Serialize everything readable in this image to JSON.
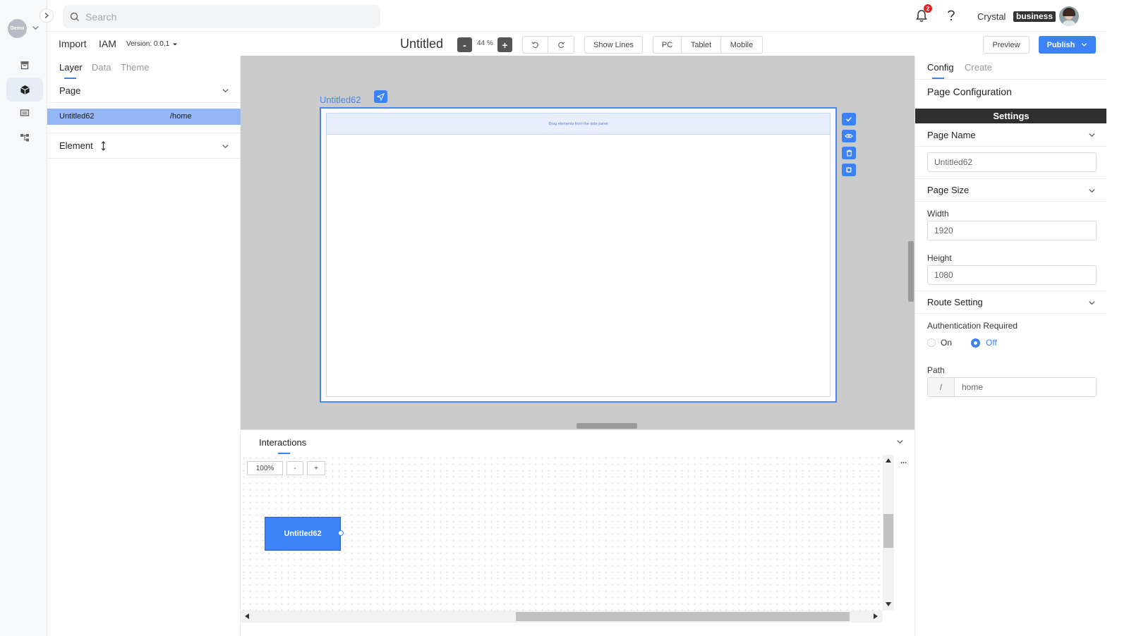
{
  "rail": {
    "workspace_label": "Demo"
  },
  "topbar": {
    "search_placeholder": "Search",
    "notification_count": "2",
    "user_name": "Crystal",
    "plan_badge": "business"
  },
  "toolbar": {
    "menu_import": "Import",
    "menu_iam": "IAM",
    "version_label": "Version: 0.0.1",
    "doc_title": "Untitled",
    "zoom_minus": "-",
    "zoom_value": "44 %",
    "zoom_plus": "+",
    "show_lines": "Show Lines",
    "device_pc": "PC",
    "device_tablet": "Tablet",
    "device_mobile": "Mobile",
    "preview": "Preview",
    "publish": "Publish"
  },
  "left_panel": {
    "tabs": [
      "Layer",
      "Data",
      "Theme"
    ],
    "page_section": "Page",
    "page_row": {
      "name": "Untitled62",
      "route": "/home"
    },
    "element_section": "Element"
  },
  "canvas": {
    "artboard_label": "Untitled62",
    "drop_hint": "Drag elements from the side panel"
  },
  "interactions": {
    "title": "Interactions",
    "zoom_value": "100%",
    "zoom_minus": "-",
    "zoom_plus": "+",
    "more": "...",
    "node_label": "Untitled62"
  },
  "right_panel": {
    "tabs": [
      "Config",
      "Create"
    ],
    "heading": "Page Configuration",
    "settings_bar": "Settings",
    "page_name_section": "Page Name",
    "page_name_value": "Untitled62",
    "page_size_section": "Page Size",
    "width_label": "Width",
    "width_value": "1920",
    "height_label": "Height",
    "height_value": "1080",
    "route_section": "Route Setting",
    "auth_label": "Authentication Required",
    "auth_on": "On",
    "auth_off": "Off",
    "auth_selected": "Off",
    "path_label": "Path",
    "path_prefix": "/",
    "path_value": "home"
  },
  "colors": {
    "accent": "#3b82f6",
    "selected_row": "#94b6f5",
    "badge_red": "#e02424"
  }
}
